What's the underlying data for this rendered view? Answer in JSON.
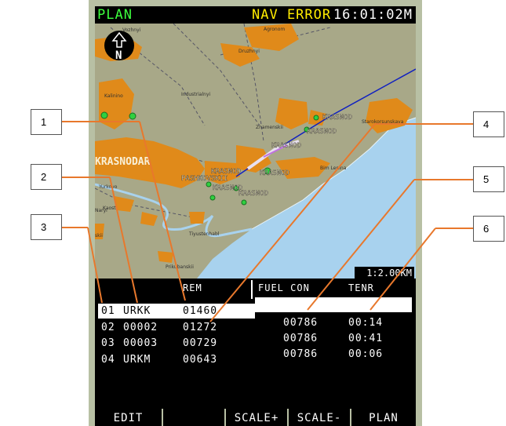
{
  "status_bar": {
    "mode": "PLAN",
    "nav_error": "NAV ERROR",
    "time": "16:01:02M"
  },
  "map": {
    "north_label": "N",
    "scale": "1:2.00KM",
    "city_label": "KRASNODAR",
    "places": [
      "Vozhnyi",
      "Agronom",
      "Druzhnyi",
      "Kalinino",
      "Industrialnyi",
      "Znamenskii",
      "Starokorsunskaya",
      "Bim Lenina",
      "Yurkovo",
      "Kaost",
      "Tiyustenhabl",
      "Prikubanskii",
      "skii",
      "Naryi"
    ],
    "waypoints": [
      "KRASNOD",
      "KRASNOD",
      "KRASNOD",
      "KRASNOD",
      "KRASNOD",
      "KRASNOD",
      "KRASNOD"
    ],
    "pashkovskii": "PASHKOVSKII"
  },
  "table": {
    "headers": {
      "rem": "REM",
      "fuel_con": "FUEL CON",
      "tenr": "TENR"
    },
    "left_rows": [
      {
        "num": "01",
        "id": "URKK",
        "rem": "01460"
      },
      {
        "num": "02",
        "id": "00002",
        "rem": "01272"
      },
      {
        "num": "03",
        "id": "00003",
        "rem": "00729"
      },
      {
        "num": "04",
        "id": "URKM",
        "rem": "00643"
      }
    ],
    "right_rows": [
      {
        "fuel": "",
        "tenr": ""
      },
      {
        "fuel": "00786",
        "tenr": "00:14"
      },
      {
        "fuel": "00786",
        "tenr": "00:41"
      },
      {
        "fuel": "00786",
        "tenr": "00:06"
      }
    ]
  },
  "softkeys": [
    "EDIT",
    "",
    "SCALE+",
    "SCALE-",
    "PLAN"
  ],
  "callouts": [
    "1",
    "2",
    "3",
    "4",
    "5",
    "6"
  ],
  "colors": {
    "terrain": "#a8a888",
    "urban": "#e08a1a",
    "water": "#a8d2ee",
    "route": "#1020c0",
    "waypoint": "#30d040"
  }
}
